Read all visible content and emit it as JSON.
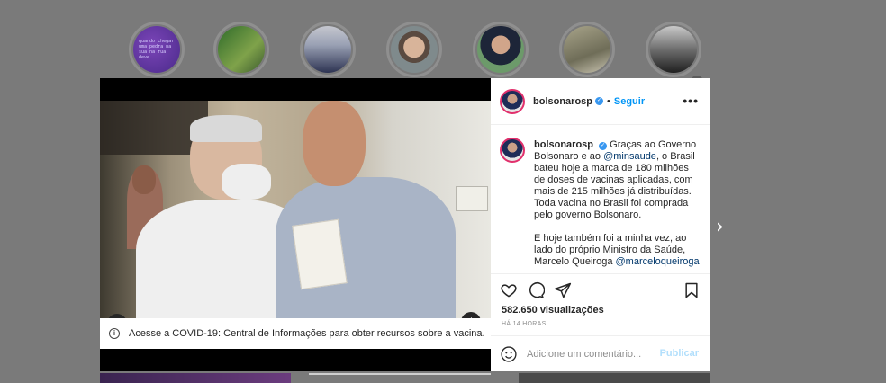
{
  "stories": [
    {
      "name": "story-1",
      "text": "quando chegar uma pedra na sua na rua deve"
    },
    {
      "name": "story-2",
      "text": ""
    },
    {
      "name": "story-3",
      "text": ""
    },
    {
      "name": "story-4",
      "text": ""
    },
    {
      "name": "story-5",
      "text": ""
    },
    {
      "name": "story-6",
      "text": ""
    },
    {
      "name": "story-7",
      "text": ""
    }
  ],
  "stories_next_glyph": "›",
  "media": {
    "notice_icon": "i",
    "notice_text": "Acesse a COVID-19: Central de Informações para obter recursos sobre a vacina.",
    "notice_chevron": "›",
    "tag_icon": "user-tag-icon",
    "mute_icon": "muted-speaker-icon"
  },
  "post": {
    "username": "bolsonarosp",
    "verified_glyph": "✓",
    "dot": "•",
    "follow_label": "Seguir",
    "more_glyph": "•••",
    "caption_username": "bolsonarosp",
    "caption_part1": "Graças ao Governo Bolsonaro e ao ",
    "caption_mention1": "@minsaude",
    "caption_part2": ", o Brasil bateu hoje a marca de 180 milhões de doses de vacinas aplicadas, com mais de 215 milhões já distribuídas. Toda vacina no Brasil foi comprada pelo governo Bolsonaro.",
    "caption_para2": "E hoje também foi a minha vez, ao lado do próprio Ministro da Saúde, Marcelo Queiroga ",
    "caption_mention2": "@marceloqueiroga",
    "views": "582.650 visualizações",
    "time": "HÁ 14 HORAS",
    "comment_placeholder": "Adicione um comentário...",
    "publish_label": "Publicar"
  },
  "modal_next_glyph": "›"
}
